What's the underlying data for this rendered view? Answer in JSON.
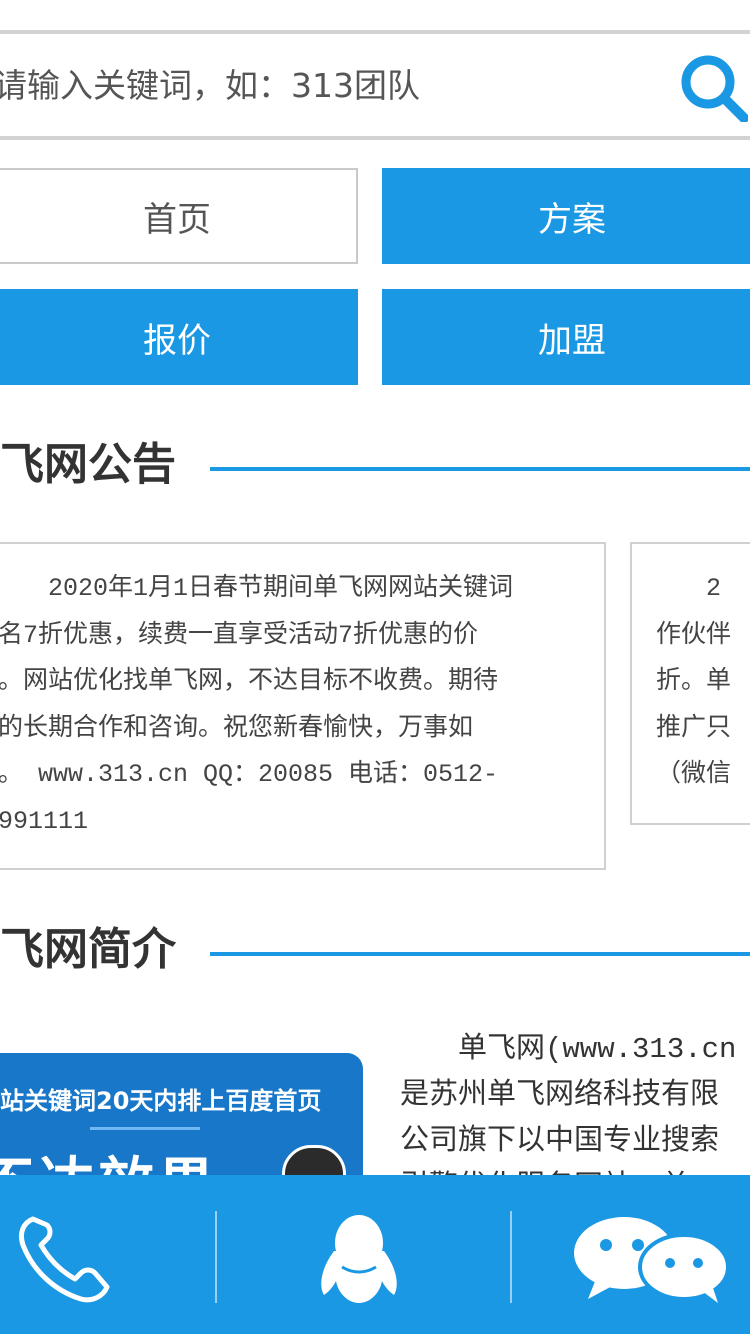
{
  "search": {
    "placeholder": "请输入关键词，如：313团队"
  },
  "nav": {
    "home": "首页",
    "plan": "方案",
    "quote": "报价",
    "join": "加盟"
  },
  "announcements": {
    "title": "飞网公告",
    "card1_lines": "　　2020年1月1日春节期间单飞网网站关键词\n名7折优惠，续费一直享受活动7折优惠的价\n。网站优化找单飞网，不达目标不收费。期待\n的长期合作和咨询。祝您新春愉快，万事如\n。 www.313.cn QQ：20085 电话：0512-\n991111",
    "card2_lines": "　　2\n作伙伴\n折。单\n推广只\n（微信"
  },
  "intro": {
    "title": "飞网简介",
    "banner_text": "站关键词20天内排上百度首页",
    "banner_big": "不达效果",
    "text_lines": "　　单飞网(www.313.cn\n是苏州单飞网络科技有限\n公司旗下以中国专业搜索\n引擎优化服务网站，单"
  },
  "colors": {
    "accent": "#1a98e3",
    "border": "#d0d0d0"
  },
  "bottom_bar": {
    "icons": [
      "phone-icon",
      "qq-icon",
      "wechat-icon"
    ]
  }
}
